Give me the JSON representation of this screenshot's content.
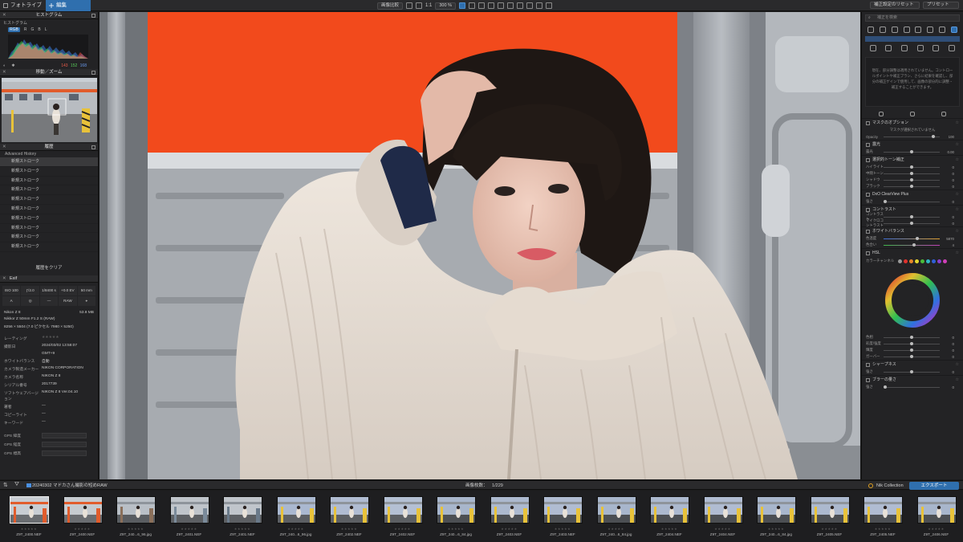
{
  "topbar": {
    "tab_browser": "フォトライブラリ",
    "tab_edit": "編集",
    "compare_label": "画像比較",
    "zoom_ratio": "1:1",
    "zoom_level": "300 %",
    "reset_label": "補正設定のリセット",
    "preset_label": "プリセット"
  },
  "left": {
    "histogram_title": "ヒストグラム",
    "histogram_sub": "ヒストグラム",
    "channels": [
      "RGB",
      "R",
      "G",
      "B",
      "L"
    ],
    "rgb_values": [
      "143",
      "152",
      "168"
    ],
    "navigator_title": "移動／ズーム",
    "history_title": "履歴",
    "history_sub": "Advanced History",
    "history_items": [
      "新規ストローク",
      "新規ストローク",
      "新規ストローク",
      "新規ストローク",
      "新規ストローク",
      "新規ストローク",
      "新規ストローク",
      "新規ストローク",
      "新規ストローク",
      "新規ストローク"
    ],
    "clear_history": "履歴をクリア",
    "exif_title": "Exif",
    "exif_cells": [
      "ISO 100",
      "ƒ/2.0",
      "1/8400 s",
      "+0.0 EV",
      "50 mm",
      "A",
      "",
      "—",
      "RAW",
      ""
    ],
    "camera": "Nikon Z 8",
    "filesize": "53.8 MB",
    "lens": "Nikkor Z 50mm F1.2 S (RAW)",
    "dimensions": "8256 × 5504 (7.0 ピクセル 7980 × 5250)",
    "rating_label": "レーティング",
    "fields": [
      {
        "k": "撮影日",
        "v": "2024/03/02 13:58:07"
      },
      {
        "k": "",
        "v": "GMT+9"
      },
      {
        "k": "ホワイトバランス",
        "v": "自動"
      },
      {
        "k": "カメラ製造メーカー",
        "v": "NIKON CORPORATION"
      },
      {
        "k": "カメラ名称",
        "v": "NIKON Z 8"
      },
      {
        "k": "シリアル番号",
        "v": "2017739"
      },
      {
        "k": "ソフトウェアバージョン",
        "v": "NIKON Z 8 Ver.04.10"
      },
      {
        "k": "著者",
        "v": "—"
      },
      {
        "k": "コピーライト",
        "v": "—"
      },
      {
        "k": "キーワード",
        "v": "—"
      }
    ],
    "gps": [
      "GPS 緯度",
      "GPS 経度",
      "GPS 標高"
    ]
  },
  "right": {
    "search_placeholder": "補正を検索",
    "help_text": "現在、部分調整は適用されていません。コントロールポイントや補正ブラシ、さらに結果を確認し、部分の補正ゲインで使用して、画像の部分的に調整・補正することができます。",
    "mask_options": "マスクのオプション",
    "mask_none": "マスクが選択されていません",
    "sections": [
      {
        "label": "マスクのオプション",
        "sliders": [
          {
            "l": "Opacity",
            "v": "100"
          }
        ]
      },
      {
        "label": "露光",
        "sliders": [
          {
            "l": "露光",
            "v": "0.00"
          }
        ]
      },
      {
        "label": "選択的トーン補正",
        "sliders": [
          {
            "l": "ハイライト",
            "v": "0"
          },
          {
            "l": "中間トーン",
            "v": "0"
          },
          {
            "l": "シャドウ",
            "v": "0"
          },
          {
            "l": "ブラック",
            "v": "0"
          }
        ]
      },
      {
        "label": "DxO ClearView Plus",
        "sliders": [
          {
            "l": "強さ",
            "v": "0"
          }
        ]
      },
      {
        "label": "コントラスト",
        "sliders": [
          {
            "l": "コントラスト",
            "v": "0"
          },
          {
            "l": "マイクロコントラスト",
            "v": "0"
          }
        ]
      },
      {
        "label": "ホワイトバランス",
        "sliders": [
          {
            "l": "色温度",
            "v": "5870"
          },
          {
            "l": "色合い",
            "v": "4"
          }
        ]
      },
      {
        "label": "HSL",
        "sliders": []
      }
    ],
    "hsl_channel": "カラーチャンネル",
    "hsl_sliders": [
      {
        "l": "色相",
        "v": "0"
      },
      {
        "l": "彩度/強度",
        "v": "0"
      },
      {
        "l": "輝度",
        "v": "0"
      },
      {
        "l": "ガーバー",
        "v": "0"
      }
    ],
    "sharpness_label": "シャープネス",
    "sharpness_slider": {
      "l": "強さ",
      "v": "0"
    },
    "blur_label": "ブラーの量さ",
    "blur_slider": {
      "l": "強さ",
      "v": "0"
    },
    "swatch_colors": [
      "#9a9a9a",
      "#e0322e",
      "#e8872a",
      "#e5d930",
      "#4bbd3a",
      "#2fb8c2",
      "#2f5fd8",
      "#8a3fd0",
      "#d03fb8"
    ]
  },
  "bottom": {
    "folder_name": "20240302 マドカさん撮影の短めRAW",
    "count_label": "画像枚数：",
    "count_value": "1/229",
    "nik_label": "Nik Collection",
    "export_label": "エクスポート"
  },
  "filmstrip": [
    "Z9T_2400.NEF",
    "Z9T_2400.NEF",
    "Z9T_240...6_96.jpg",
    "Z9T_2401.NEF",
    "Z9T_2401.NEF",
    "Z9T_240...6_96.jpg",
    "Z9T_2402.NEF",
    "Z9T_2402.NEF",
    "Z9T_240...6_84.jpg",
    "Z9T_2403.NEF",
    "Z9T_2403.NEF",
    "Z9T_240...6_84.jpg",
    "Z9T_2404.NEF",
    "Z9T_2404.NEF",
    "Z9T_240...6_84.jpg",
    "Z9T_2405.NEF",
    "Z9T_2405.NEF",
    "Z9T_2406.NEF"
  ],
  "colors": {
    "accent": "#2f6fae",
    "panel": "#232325",
    "train_orange": "#f24a1c"
  }
}
